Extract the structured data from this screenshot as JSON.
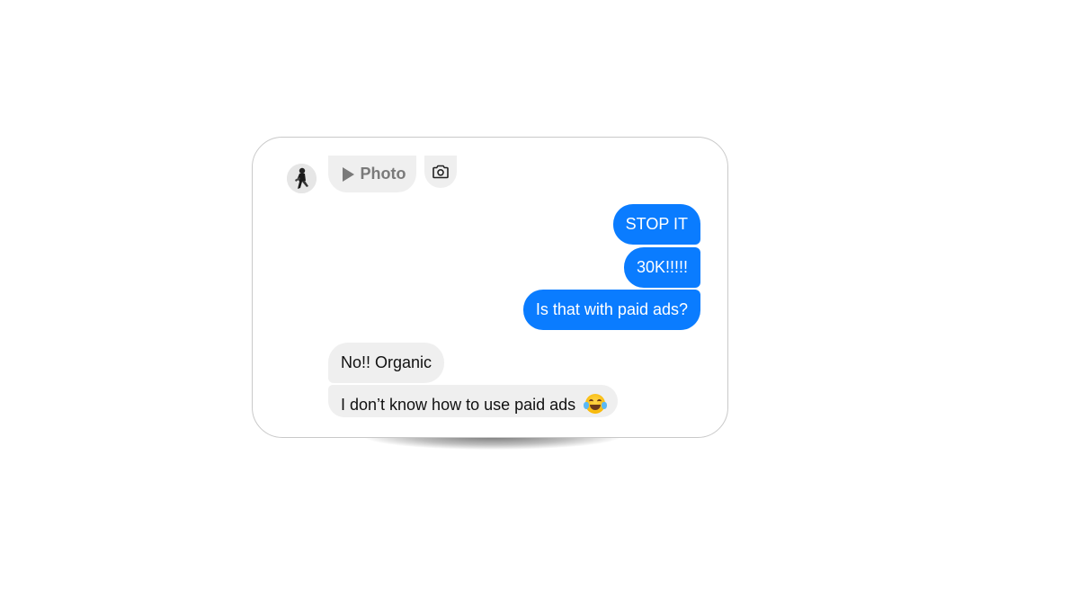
{
  "thread": {
    "header_attachment": {
      "icon": "play-icon",
      "label": "Photo"
    },
    "camera_button": {
      "icon": "camera-icon"
    },
    "messages": [
      {
        "direction": "outgoing",
        "text": "STOP IT"
      },
      {
        "direction": "outgoing",
        "text": "30K!!!!!"
      },
      {
        "direction": "outgoing",
        "text": "Is that with paid ads?"
      },
      {
        "direction": "incoming",
        "text": "No!! Organic"
      },
      {
        "direction": "incoming",
        "text": "I don’t know how to use paid ads",
        "emoji": "face-with-tears-of-joy"
      }
    ]
  },
  "colors": {
    "outgoing_bubble": "#0a7cff",
    "incoming_bubble": "#efefef",
    "outgoing_text": "#ffffff",
    "incoming_text": "#111111"
  }
}
